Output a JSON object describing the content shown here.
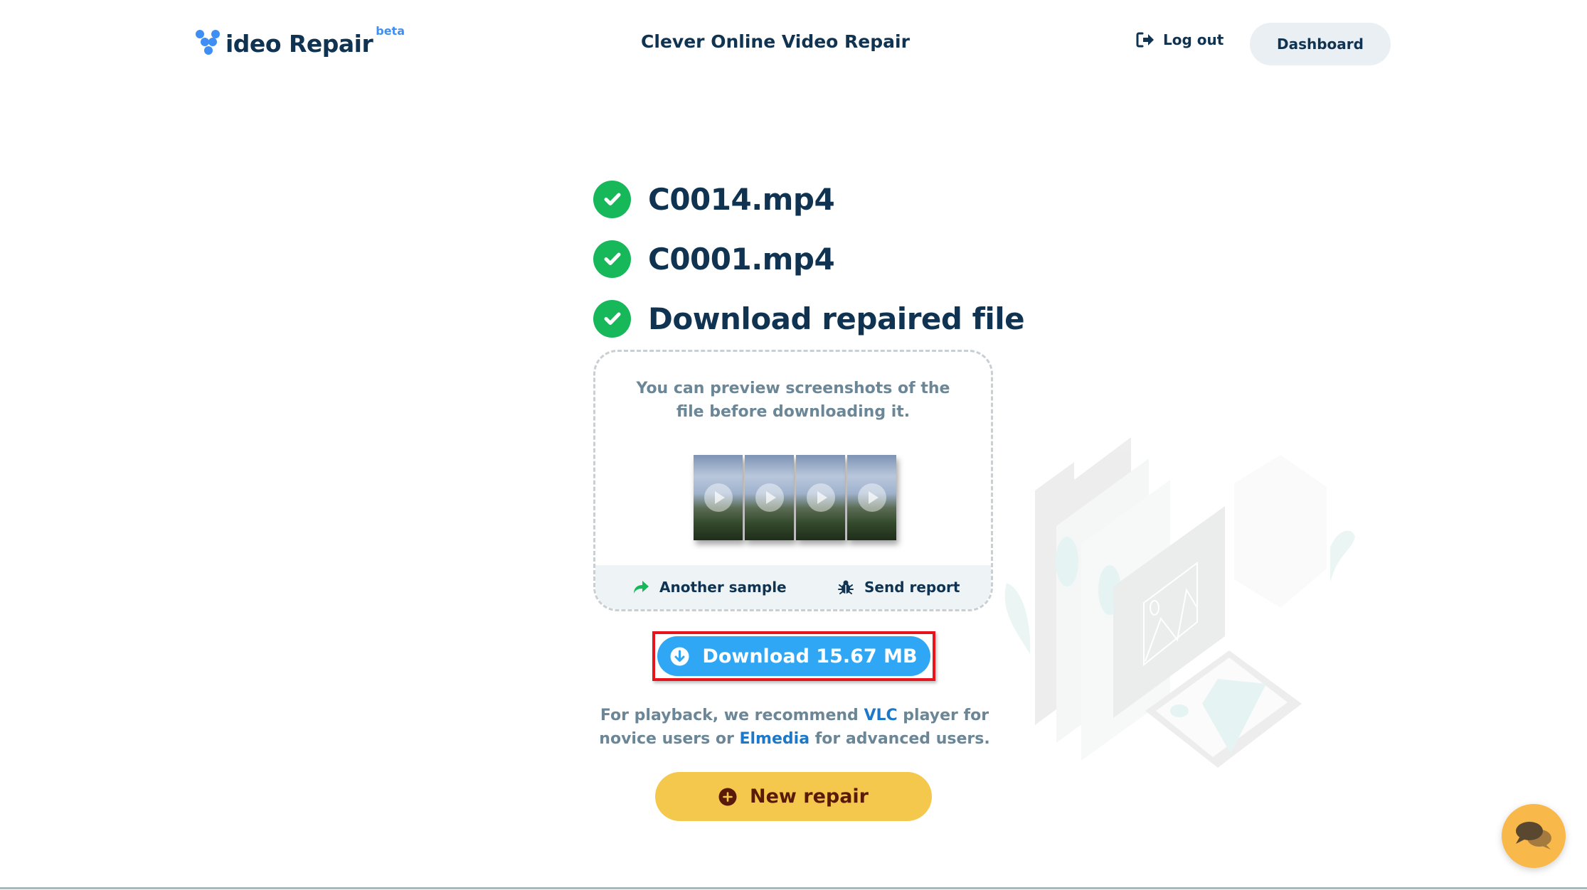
{
  "header": {
    "logo_text": "ideo Repair",
    "logo_badge": "beta",
    "title": "Clever Online Video Repair",
    "logout_label": "Log out",
    "dashboard_label": "Dashboard"
  },
  "steps": [
    {
      "label": "C0014.mp4",
      "status": "done"
    },
    {
      "label": "C0001.mp4",
      "status": "done"
    },
    {
      "label": "Download repaired file",
      "status": "done"
    }
  ],
  "preview": {
    "text": "You can preview screenshots of the file before downloading it.",
    "thumbnail_count": 4,
    "another_sample_label": "Another sample",
    "send_report_label": "Send report"
  },
  "download": {
    "label": "Download 15.67 MB"
  },
  "recommendation": {
    "part1": "For playback, we recommend ",
    "link1": "VLC",
    "part2": " player for novice users or ",
    "link2": "Elmedia",
    "part3": " for advanced users."
  },
  "new_repair": {
    "label": "New repair"
  },
  "colors": {
    "brand_blue": "#3f8ef4",
    "text_dark": "#0f3350",
    "success_green": "#17b85a",
    "download_blue": "#30a7f4",
    "highlight_red": "#e8141c",
    "new_repair_yellow": "#f4c84c",
    "chat_orange": "#f8b84a"
  }
}
